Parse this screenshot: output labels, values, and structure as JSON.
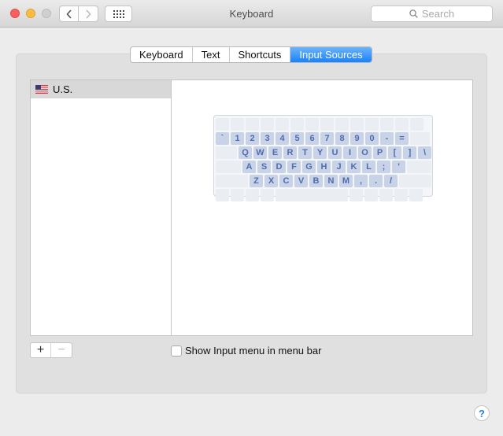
{
  "window": {
    "title": "Keyboard",
    "search_placeholder": "Search"
  },
  "tabs": [
    {
      "label": "Keyboard",
      "active": false
    },
    {
      "label": "Text",
      "active": false
    },
    {
      "label": "Shortcuts",
      "active": false
    },
    {
      "label": "Input Sources",
      "active": true
    }
  ],
  "input_sources": [
    {
      "label": "U.S.",
      "icon": "us-flag-icon",
      "selected": true
    }
  ],
  "keyboard_rows": [
    [
      "`",
      "1",
      "2",
      "3",
      "4",
      "5",
      "6",
      "7",
      "8",
      "9",
      "0",
      "-",
      "="
    ],
    [
      "Q",
      "W",
      "E",
      "R",
      "T",
      "Y",
      "U",
      "I",
      "O",
      "P",
      "[",
      "]",
      "\\"
    ],
    [
      "A",
      "S",
      "D",
      "F",
      "G",
      "H",
      "J",
      "K",
      "L",
      ";",
      "'"
    ],
    [
      "Z",
      "X",
      "C",
      "V",
      "B",
      "N",
      "M",
      ",",
      ".",
      "/"
    ]
  ],
  "controls": {
    "add_label": "+",
    "remove_label": "−",
    "show_input_menu_label": "Show Input menu in menu bar",
    "show_input_menu_checked": false,
    "help_label": "?"
  },
  "colors": {
    "accent": "#1a82fb",
    "key_text": "#4f6cae"
  }
}
